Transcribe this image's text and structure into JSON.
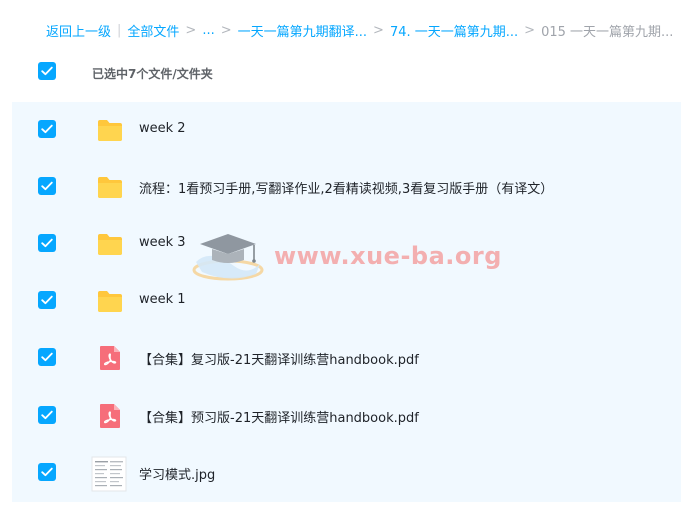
{
  "breadcrumb": {
    "back": "返回上一级",
    "all_files": "全部文件",
    "ellipsis": "...",
    "level1": "一天一篇第九期翻译...",
    "level2": "74. 一天一篇第九期...",
    "current": "015 一天一篇第九期..."
  },
  "selection": {
    "label": "已选中7个文件/文件夹"
  },
  "files": [
    {
      "name": "week 2",
      "icon": "folder-icon",
      "checked": true
    },
    {
      "name": "流程：1看预习手册,写翻译作业,2看精读视频,3看复习版手册（有译文）",
      "icon": "folder-icon",
      "checked": true
    },
    {
      "name": "week 3",
      "icon": "folder-icon",
      "checked": true
    },
    {
      "name": "week 1",
      "icon": "folder-icon",
      "checked": true
    },
    {
      "name": "【合集】复习版-21天翻译训练营handbook.pdf",
      "icon": "pdf-icon",
      "checked": true
    },
    {
      "name": "【合集】预习版-21天翻译训练营handbook.pdf",
      "icon": "pdf-icon",
      "checked": true
    },
    {
      "name": "学习模式.jpg",
      "icon": "image-thumbnail-icon",
      "checked": true
    }
  ],
  "watermark": {
    "text": "www.xue-ba.org"
  },
  "colors": {
    "accent": "#06a7ff",
    "selected_row_bg": "#f1f9ff",
    "folder": "#ffc73c",
    "pdf": "#f66e7a",
    "watermark": "#f4a3a3"
  }
}
